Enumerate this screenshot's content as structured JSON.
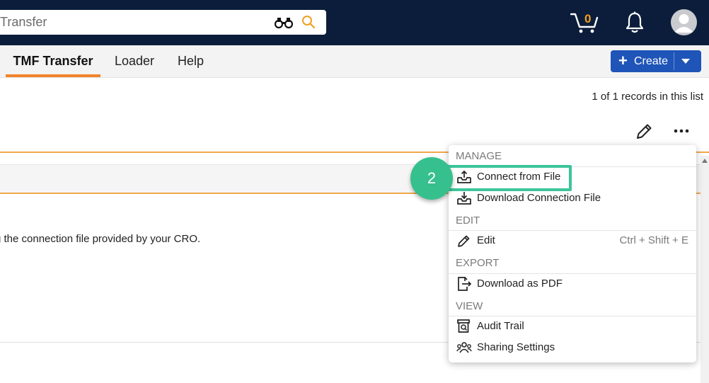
{
  "search": {
    "value": "Transfer",
    "search_icon": "magnifier-icon",
    "binoculars_icon": "binoculars-icon"
  },
  "header": {
    "cart_count": "0",
    "icons": [
      "cart-icon",
      "bell-icon",
      "user-avatar-icon"
    ],
    "accent": "#f0a020"
  },
  "tabs": [
    {
      "label": "TMF Transfer",
      "active": true
    },
    {
      "label": "Loader",
      "active": false
    },
    {
      "label": "Help",
      "active": false
    }
  ],
  "create_button": {
    "label": "Create",
    "color": "#1f55b8"
  },
  "list": {
    "records_text": "1 of 1 records in this list"
  },
  "content": {
    "description": "g the connection file provided by your CRO."
  },
  "menu": {
    "sections": [
      {
        "title": "MANAGE",
        "items": [
          {
            "label": "Connect from File",
            "icon": "upload-tray-icon"
          },
          {
            "label": "Download Connection File",
            "icon": "download-tray-icon"
          }
        ]
      },
      {
        "title": "EDIT",
        "items": [
          {
            "label": "Edit",
            "icon": "pencil-icon",
            "shortcut": "Ctrl + Shift + E"
          }
        ]
      },
      {
        "title": "EXPORT",
        "items": [
          {
            "label": "Download as PDF",
            "icon": "export-file-icon"
          }
        ]
      },
      {
        "title": "VIEW",
        "items": [
          {
            "label": "Audit Trail",
            "icon": "audit-icon"
          },
          {
            "label": "Sharing Settings",
            "icon": "users-icon"
          }
        ]
      }
    ]
  },
  "callout": {
    "step": "2",
    "color": "#36c08e"
  }
}
